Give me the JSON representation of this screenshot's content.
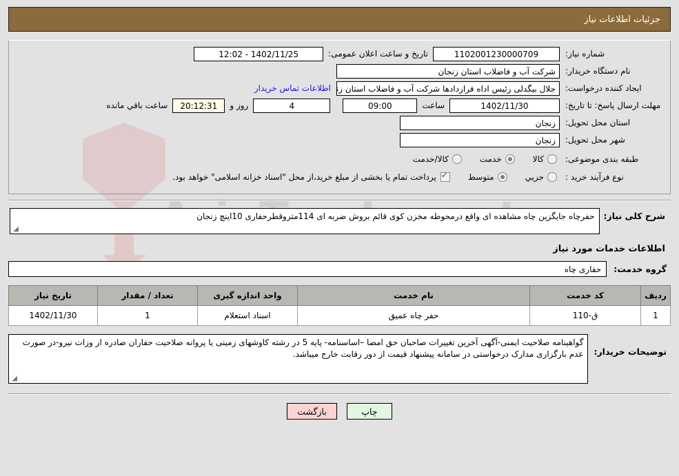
{
  "window": {
    "title": "جزئیات اطلاعات نیاز"
  },
  "form": {
    "need_number_label": "شماره نیاز:",
    "need_number_value": "1102001230000709",
    "announce_label": "تاریخ و ساعت اعلان عمومی:",
    "announce_value": "1402/11/25 - 12:02",
    "buyer_org_label": "نام دستگاه خریدار:",
    "buyer_org_value": "شرکت آب و فاضلاب استان زنجان",
    "requester_label": "ایجاد کننده درخواست:",
    "requester_value": "جلال بیگدلی رئیس اداه قراردادها شرکت آب و فاضلاب استان زنجان",
    "contact_link": "اطلاعات تماس خریدار",
    "deadline_label": "مهلت ارسال پاسخ: تا تاریخ:",
    "deadline_date": "1402/11/30",
    "hour_label": "ساعت",
    "hour_value": "09:00",
    "days_value": "4",
    "days_unit_label": "روز و",
    "remaining_value": "20:12:31",
    "remaining_label": "ساعت باقي مانده",
    "province_label": "استان محل تحویل:",
    "province_value": "زنجان",
    "city_label": "شهر محل تحویل:",
    "city_value": "زنجان",
    "category_label": "طبقه بندی موضوعی:",
    "category_options": [
      {
        "label": "کالا",
        "selected": false
      },
      {
        "label": "خدمت",
        "selected": true
      },
      {
        "label": "کالا/خدمت",
        "selected": false
      }
    ],
    "process_label": "نوع فرآیند خرید :",
    "process_options": [
      {
        "label": "جزیي",
        "selected": false
      },
      {
        "label": "متوسط",
        "selected": true
      }
    ],
    "payment_checkbox_checked": true,
    "payment_note": "پرداخت تمام یا بخشی از مبلغ خرید،از محل \"اسناد خزانه اسلامی\" خواهد بود."
  },
  "description": {
    "label": "شرح کلی نیاز:",
    "value": "حفرچاه جایگزین چاه مشاهده ای واقع درمحوطه مخزن کوی قائم بروش ضربه ای 114متروقطرحفاری 10اینچ زنجان"
  },
  "services": {
    "section_title": "اطلاعات خدمات مورد نیاز",
    "group_label": "گروه خدمت:",
    "group_value": "حفاری چاه",
    "table": {
      "headers": [
        "ردیف",
        "کد خدمت",
        "نام خدمت",
        "واحد اندازه گیری",
        "تعداد / مقدار",
        "تاریخ نیاز"
      ],
      "rows": [
        {
          "radif": "1",
          "code": "ق-110",
          "name": "حفر چاه عمیق",
          "unit": "اسناد استعلام",
          "qty": "1",
          "date": "1402/11/30"
        }
      ]
    }
  },
  "notes": {
    "label": "توضیحات خریدار:",
    "value": "گواهینامه صلاحیت ایمنی-آگهی آخرین تغییرات صاحبان حق امضا –اساسنامه- پایه 5 در رشته کاوشهای زمینی یا پروانه صلاحیت حفاران صادره از وزات نیرو-در صورت عدم بارگزاری مدارک درخواستی در سامانه پیشنهاد قیمت از دور رقابت خارج میباشد."
  },
  "footer": {
    "print_label": "چاپ",
    "back_label": "بازگشت"
  },
  "watermark": {
    "text": "AriaTender.net"
  },
  "colors": {
    "title_bar": "#8b6b3d",
    "link": "#1a1ae0",
    "table_header": "#b8b8b3",
    "print_button": "#e3f6e1",
    "back_button": "#fad3d3"
  }
}
